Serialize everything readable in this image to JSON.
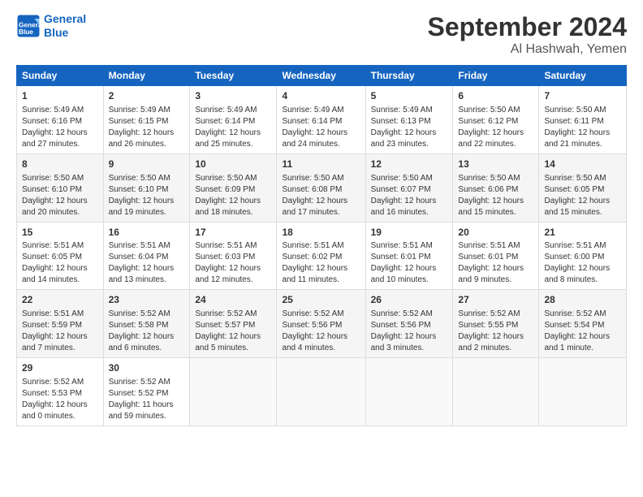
{
  "header": {
    "logo_line1": "General",
    "logo_line2": "Blue",
    "month": "September 2024",
    "location": "Al Hashwah, Yemen"
  },
  "days_of_week": [
    "Sunday",
    "Monday",
    "Tuesday",
    "Wednesday",
    "Thursday",
    "Friday",
    "Saturday"
  ],
  "weeks": [
    [
      {
        "day": "1",
        "lines": [
          "Sunrise: 5:49 AM",
          "Sunset: 6:16 PM",
          "Daylight: 12 hours",
          "and 27 minutes."
        ]
      },
      {
        "day": "2",
        "lines": [
          "Sunrise: 5:49 AM",
          "Sunset: 6:15 PM",
          "Daylight: 12 hours",
          "and 26 minutes."
        ]
      },
      {
        "day": "3",
        "lines": [
          "Sunrise: 5:49 AM",
          "Sunset: 6:14 PM",
          "Daylight: 12 hours",
          "and 25 minutes."
        ]
      },
      {
        "day": "4",
        "lines": [
          "Sunrise: 5:49 AM",
          "Sunset: 6:14 PM",
          "Daylight: 12 hours",
          "and 24 minutes."
        ]
      },
      {
        "day": "5",
        "lines": [
          "Sunrise: 5:49 AM",
          "Sunset: 6:13 PM",
          "Daylight: 12 hours",
          "and 23 minutes."
        ]
      },
      {
        "day": "6",
        "lines": [
          "Sunrise: 5:50 AM",
          "Sunset: 6:12 PM",
          "Daylight: 12 hours",
          "and 22 minutes."
        ]
      },
      {
        "day": "7",
        "lines": [
          "Sunrise: 5:50 AM",
          "Sunset: 6:11 PM",
          "Daylight: 12 hours",
          "and 21 minutes."
        ]
      }
    ],
    [
      {
        "day": "8",
        "lines": [
          "Sunrise: 5:50 AM",
          "Sunset: 6:10 PM",
          "Daylight: 12 hours",
          "and 20 minutes."
        ]
      },
      {
        "day": "9",
        "lines": [
          "Sunrise: 5:50 AM",
          "Sunset: 6:10 PM",
          "Daylight: 12 hours",
          "and 19 minutes."
        ]
      },
      {
        "day": "10",
        "lines": [
          "Sunrise: 5:50 AM",
          "Sunset: 6:09 PM",
          "Daylight: 12 hours",
          "and 18 minutes."
        ]
      },
      {
        "day": "11",
        "lines": [
          "Sunrise: 5:50 AM",
          "Sunset: 6:08 PM",
          "Daylight: 12 hours",
          "and 17 minutes."
        ]
      },
      {
        "day": "12",
        "lines": [
          "Sunrise: 5:50 AM",
          "Sunset: 6:07 PM",
          "Daylight: 12 hours",
          "and 16 minutes."
        ]
      },
      {
        "day": "13",
        "lines": [
          "Sunrise: 5:50 AM",
          "Sunset: 6:06 PM",
          "Daylight: 12 hours",
          "and 15 minutes."
        ]
      },
      {
        "day": "14",
        "lines": [
          "Sunrise: 5:50 AM",
          "Sunset: 6:05 PM",
          "Daylight: 12 hours",
          "and 15 minutes."
        ]
      }
    ],
    [
      {
        "day": "15",
        "lines": [
          "Sunrise: 5:51 AM",
          "Sunset: 6:05 PM",
          "Daylight: 12 hours",
          "and 14 minutes."
        ]
      },
      {
        "day": "16",
        "lines": [
          "Sunrise: 5:51 AM",
          "Sunset: 6:04 PM",
          "Daylight: 12 hours",
          "and 13 minutes."
        ]
      },
      {
        "day": "17",
        "lines": [
          "Sunrise: 5:51 AM",
          "Sunset: 6:03 PM",
          "Daylight: 12 hours",
          "and 12 minutes."
        ]
      },
      {
        "day": "18",
        "lines": [
          "Sunrise: 5:51 AM",
          "Sunset: 6:02 PM",
          "Daylight: 12 hours",
          "and 11 minutes."
        ]
      },
      {
        "day": "19",
        "lines": [
          "Sunrise: 5:51 AM",
          "Sunset: 6:01 PM",
          "Daylight: 12 hours",
          "and 10 minutes."
        ]
      },
      {
        "day": "20",
        "lines": [
          "Sunrise: 5:51 AM",
          "Sunset: 6:01 PM",
          "Daylight: 12 hours",
          "and 9 minutes."
        ]
      },
      {
        "day": "21",
        "lines": [
          "Sunrise: 5:51 AM",
          "Sunset: 6:00 PM",
          "Daylight: 12 hours",
          "and 8 minutes."
        ]
      }
    ],
    [
      {
        "day": "22",
        "lines": [
          "Sunrise: 5:51 AM",
          "Sunset: 5:59 PM",
          "Daylight: 12 hours",
          "and 7 minutes."
        ]
      },
      {
        "day": "23",
        "lines": [
          "Sunrise: 5:52 AM",
          "Sunset: 5:58 PM",
          "Daylight: 12 hours",
          "and 6 minutes."
        ]
      },
      {
        "day": "24",
        "lines": [
          "Sunrise: 5:52 AM",
          "Sunset: 5:57 PM",
          "Daylight: 12 hours",
          "and 5 minutes."
        ]
      },
      {
        "day": "25",
        "lines": [
          "Sunrise: 5:52 AM",
          "Sunset: 5:56 PM",
          "Daylight: 12 hours",
          "and 4 minutes."
        ]
      },
      {
        "day": "26",
        "lines": [
          "Sunrise: 5:52 AM",
          "Sunset: 5:56 PM",
          "Daylight: 12 hours",
          "and 3 minutes."
        ]
      },
      {
        "day": "27",
        "lines": [
          "Sunrise: 5:52 AM",
          "Sunset: 5:55 PM",
          "Daylight: 12 hours",
          "and 2 minutes."
        ]
      },
      {
        "day": "28",
        "lines": [
          "Sunrise: 5:52 AM",
          "Sunset: 5:54 PM",
          "Daylight: 12 hours",
          "and 1 minute."
        ]
      }
    ],
    [
      {
        "day": "29",
        "lines": [
          "Sunrise: 5:52 AM",
          "Sunset: 5:53 PM",
          "Daylight: 12 hours",
          "and 0 minutes."
        ]
      },
      {
        "day": "30",
        "lines": [
          "Sunrise: 5:52 AM",
          "Sunset: 5:52 PM",
          "Daylight: 11 hours",
          "and 59 minutes."
        ]
      },
      {
        "day": "",
        "lines": []
      },
      {
        "day": "",
        "lines": []
      },
      {
        "day": "",
        "lines": []
      },
      {
        "day": "",
        "lines": []
      },
      {
        "day": "",
        "lines": []
      }
    ]
  ]
}
